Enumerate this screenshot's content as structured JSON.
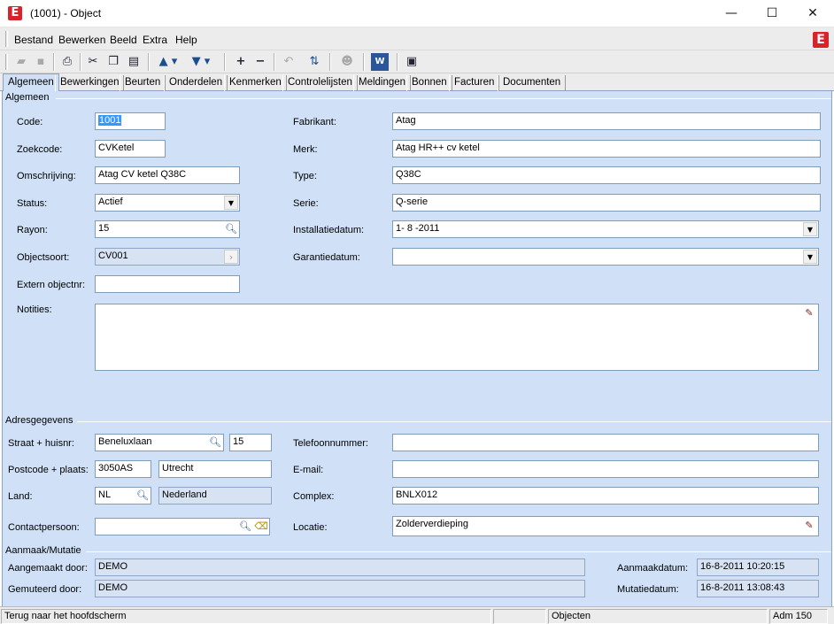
{
  "window": {
    "title": "(1001) - Object",
    "app_logo_letter": "E",
    "minimize_glyph": "—",
    "maximize_glyph": "☐",
    "close_glyph": "✕"
  },
  "menu": {
    "items": [
      "Bestand",
      "Bewerken",
      "Beeld",
      "Extra",
      "Help"
    ]
  },
  "toolbar": {
    "icons": [
      "open-folder-icon",
      "save-icon",
      "print-icon",
      "cut-icon",
      "copy-icon",
      "paste-icon",
      "arrow-up-icon",
      "arrow-down-icon",
      "add-icon",
      "remove-icon",
      "undo-icon",
      "refresh-icon",
      "user-icon",
      "word-icon",
      "window-icon"
    ]
  },
  "tabs": [
    "Algemeen",
    "Bewerkingen",
    "Beurten",
    "Onderdelen",
    "Kenmerken",
    "Controlelijsten",
    "Meldingen",
    "Bonnen",
    "Facturen",
    "Documenten"
  ],
  "algemeen": {
    "group_title": "Algemeen",
    "code": {
      "label": "Code:",
      "value": "1001"
    },
    "zoekcode": {
      "label": "Zoekcode:",
      "value": "CVKetel"
    },
    "omschrijving": {
      "label": "Omschrijving:",
      "value": "Atag CV ketel Q38C"
    },
    "status": {
      "label": "Status:",
      "value": "Actief"
    },
    "rayon": {
      "label": "Rayon:",
      "value": "15"
    },
    "objectsoort": {
      "label": "Objectsoort:",
      "value": "CV001"
    },
    "extern": {
      "label": "Extern objectnr:",
      "value": ""
    },
    "notities": {
      "label": "Notities:",
      "value": ""
    },
    "fabrikant": {
      "label": "Fabrikant:",
      "value": "Atag"
    },
    "merk": {
      "label": "Merk:",
      "value": "Atag HR++ cv ketel"
    },
    "type": {
      "label": "Type:",
      "value": "Q38C"
    },
    "serie": {
      "label": "Serie:",
      "value": "Q-serie"
    },
    "installatiedatum": {
      "label": "Installatiedatum:",
      "value": "1- 8 -2011"
    },
    "garantiedatum": {
      "label": "Garantiedatum:",
      "value": ""
    }
  },
  "adres": {
    "group_title": "Adresgegevens",
    "straat": {
      "label": "Straat + huisnr:",
      "value": "Beneluxlaan",
      "huisnr": "15"
    },
    "postcode": {
      "label": "Postcode + plaats:",
      "value": "3050AS",
      "plaats": "Utrecht"
    },
    "land": {
      "label": "Land:",
      "code": "NL",
      "name": "Nederland"
    },
    "contactpersoon": {
      "label": "Contactpersoon:",
      "value": ""
    },
    "telefoon": {
      "label": "Telefoonnummer:",
      "value": ""
    },
    "email": {
      "label": "E-mail:",
      "value": ""
    },
    "complex": {
      "label": "Complex:",
      "value": "BNLX012"
    },
    "locatie": {
      "label": "Locatie:",
      "value": "Zolderverdieping"
    }
  },
  "mutatie": {
    "group_title": "Aanmaak/Mutatie",
    "aangemaakt": {
      "label": "Aangemaakt door:",
      "value": "DEMO"
    },
    "gemuteerd": {
      "label": "Gemuteerd door:",
      "value": "DEMO"
    },
    "aanmaakdatum": {
      "label": "Aanmaakdatum:",
      "value": "16-8-2011 10:20:15"
    },
    "mutatiedatum": {
      "label": "Mutatiedatum:",
      "value": "16-8-2011 13:08:43"
    }
  },
  "statusbar": {
    "message": "Terug naar het hoofdscherm",
    "module": "Objecten",
    "user": "Adm 150"
  }
}
